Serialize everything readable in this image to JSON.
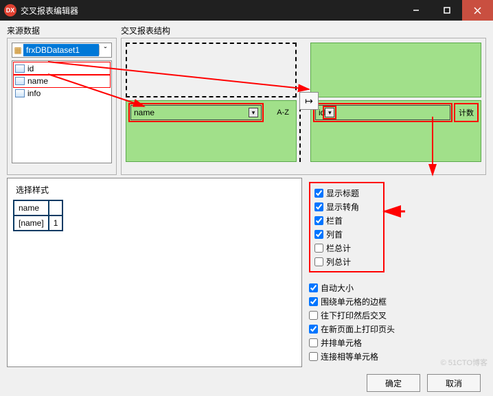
{
  "window": {
    "title": "交叉报表编辑器",
    "app_badge": "DX"
  },
  "labels": {
    "source": "来源数据",
    "structure": "交叉报表结构",
    "select_style": "选择样式"
  },
  "dataset": {
    "selected": "frxDBDataset1"
  },
  "fields": {
    "f0": "id",
    "f1": "name",
    "f2": "info"
  },
  "struct": {
    "row_field": "name",
    "row_sort": "A-Z",
    "col_field": "id",
    "col_agg": "计数",
    "center_icon": "↦"
  },
  "preview": {
    "header": "name",
    "cell_label": "[name]",
    "cell_value": "1"
  },
  "checks1": {
    "show_title": {
      "label": "显示标题",
      "checked": true
    },
    "show_corner": {
      "label": "显示转角",
      "checked": true
    },
    "col_header": {
      "label": "栏首",
      "checked": true
    },
    "row_header": {
      "label": "列首",
      "checked": true
    },
    "col_total": {
      "label": "栏总计",
      "checked": false
    },
    "row_total": {
      "label": "列总计",
      "checked": false
    }
  },
  "checks2": {
    "auto_size": {
      "label": "自动大小",
      "checked": true
    },
    "cell_border": {
      "label": "围绕单元格的边框",
      "checked": true
    },
    "print_cross": {
      "label": "往下打印然后交叉",
      "checked": false
    },
    "reprint_hdr": {
      "label": "在新页面上打印页头",
      "checked": true
    },
    "side_cells": {
      "label": "并排单元格",
      "checked": false
    },
    "join_equal": {
      "label": "连接相等单元格",
      "checked": false
    }
  },
  "buttons": {
    "ok": "确定",
    "cancel": "取消"
  },
  "watermark": "© 51CTO博客"
}
